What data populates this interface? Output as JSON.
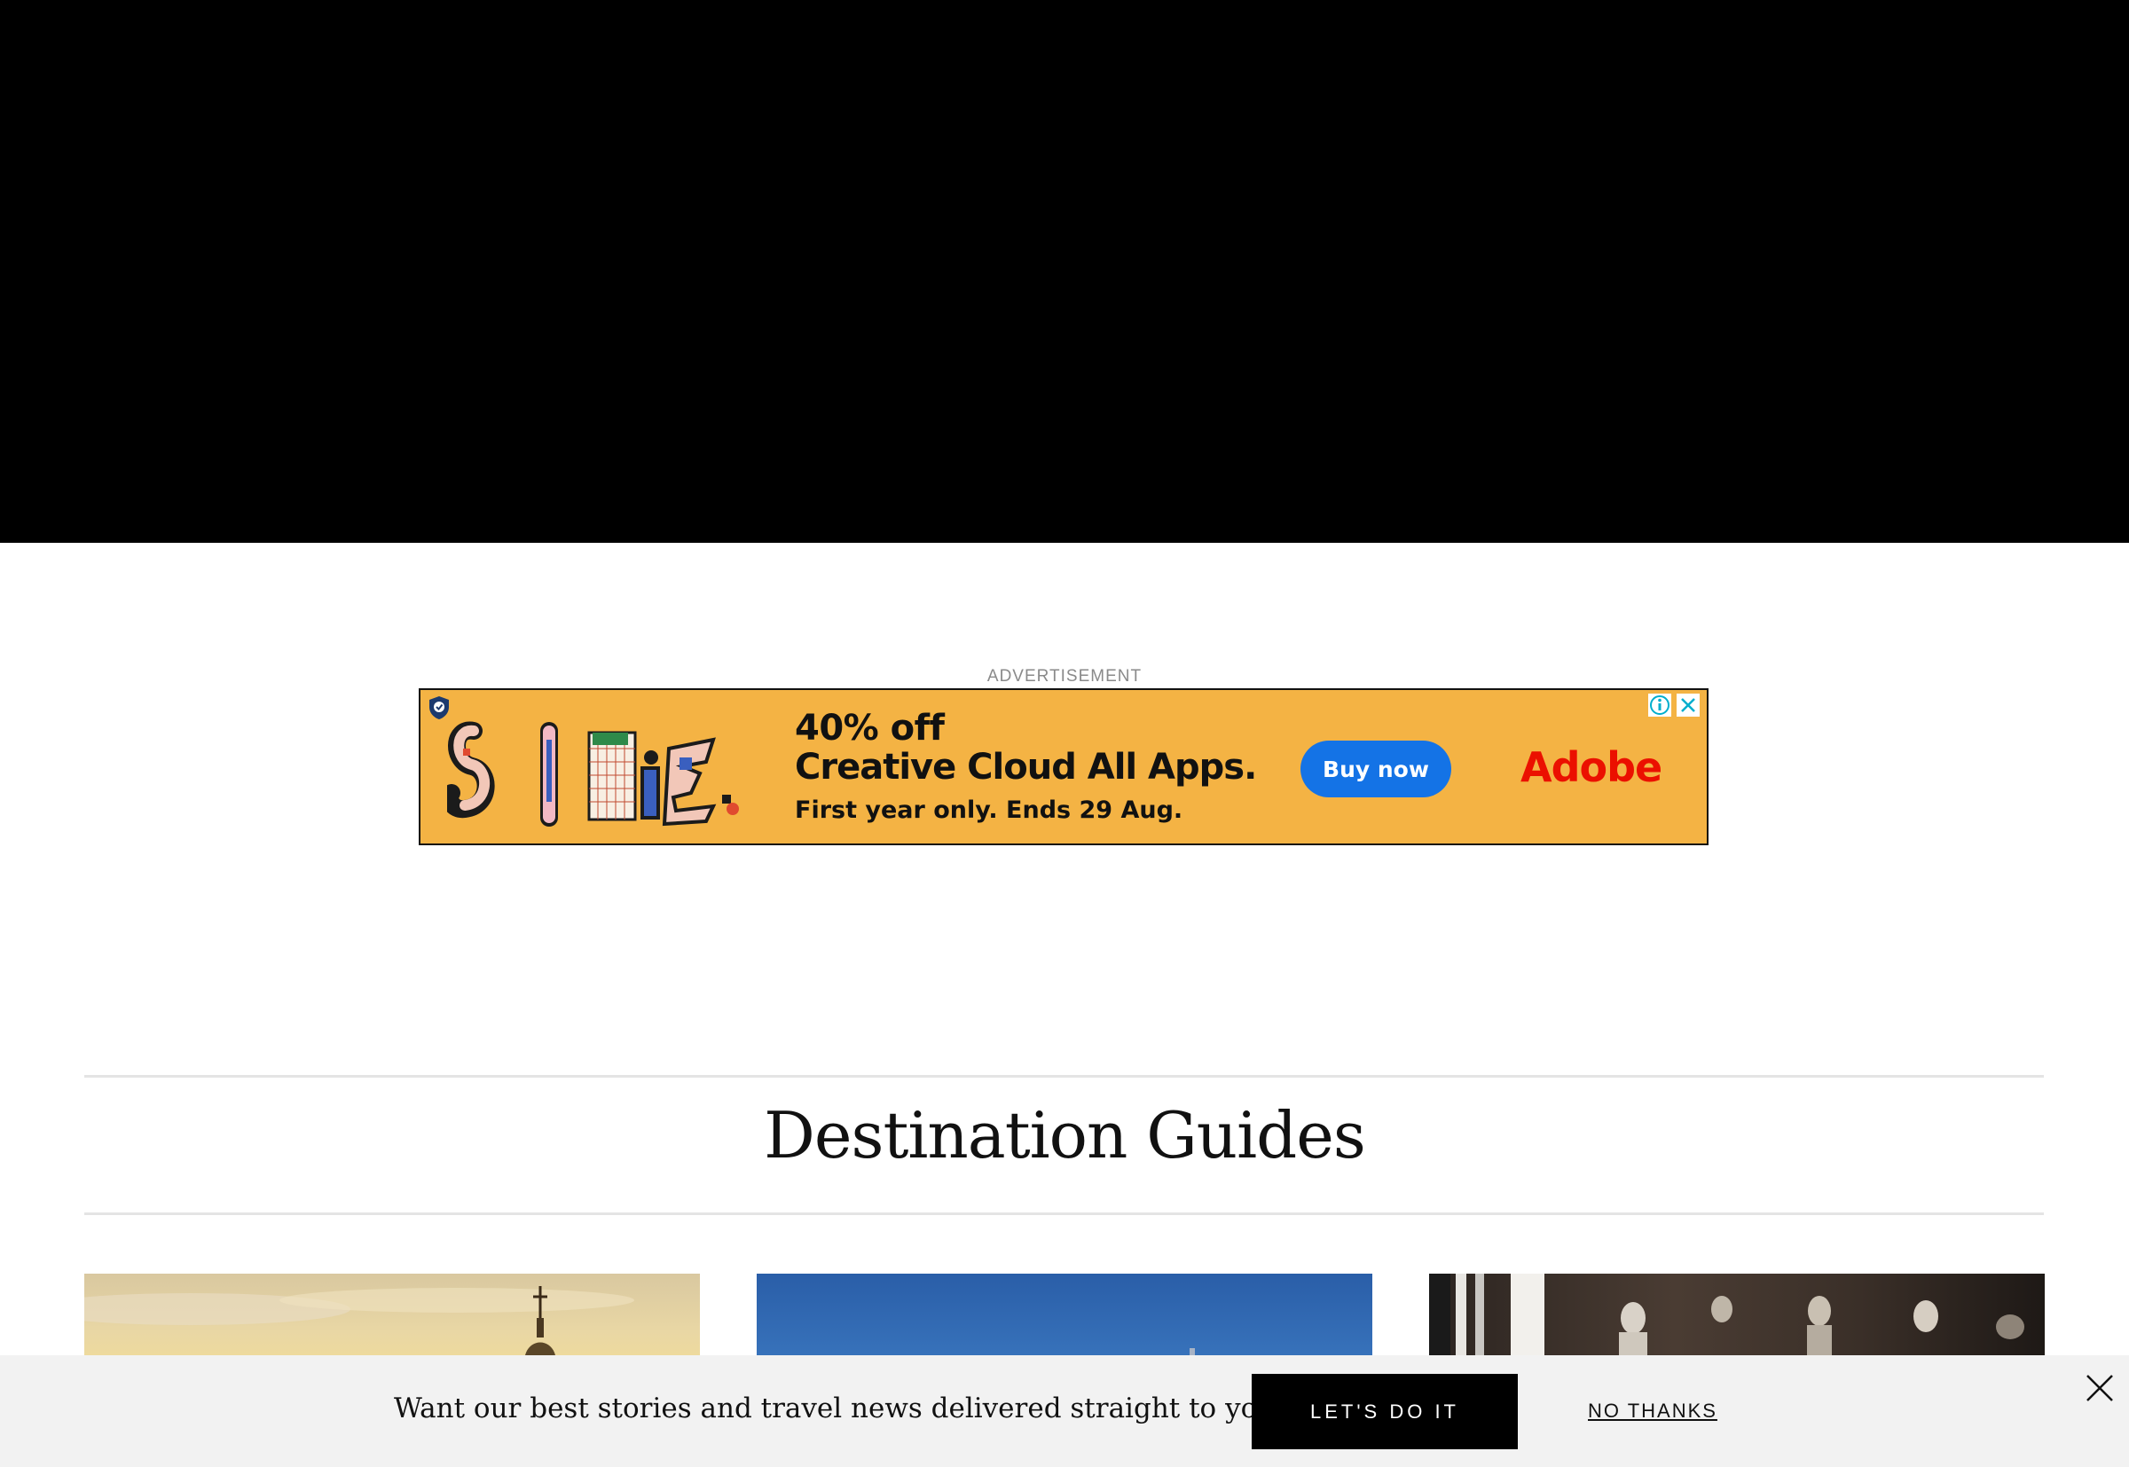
{
  "hero": {},
  "advertisement": {
    "label": "ADVERTISEMENT",
    "headline": "40% off",
    "product": "Creative Cloud All Apps.",
    "offer": "First year only. Ends 29 Aug.",
    "cta": "Buy now",
    "brand": "Adobe",
    "colors": {
      "background": "#f4b344",
      "button": "#1473e6",
      "brand": "#eb1000"
    }
  },
  "section": {
    "title": "Destination Guides",
    "cards": [
      {
        "name": "guide-card-1"
      },
      {
        "name": "guide-card-2"
      },
      {
        "name": "guide-card-3"
      }
    ]
  },
  "newsletter": {
    "prompt": "Want our best stories and travel news delivered straight to you?",
    "accept": "LET'S DO IT",
    "decline": "NO THANKS",
    "close_icon": "close-icon"
  }
}
